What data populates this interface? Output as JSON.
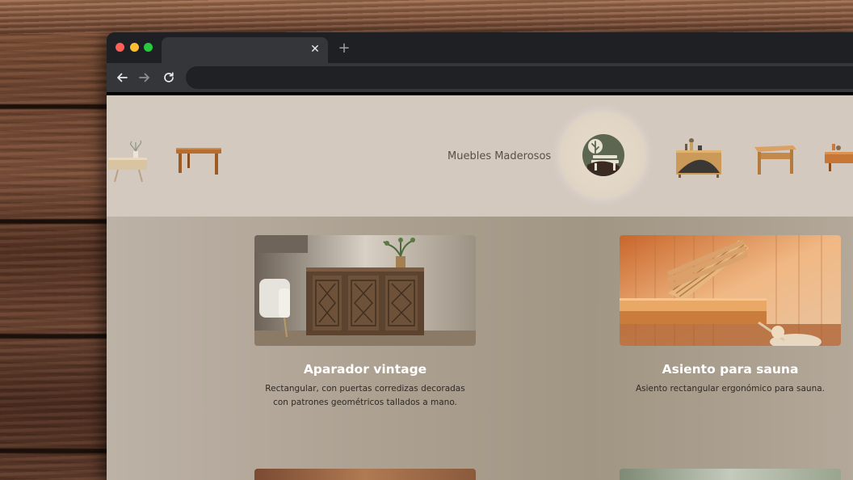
{
  "site": {
    "brand_name": "Muebles Maderosos"
  },
  "browser": {
    "tab_close_glyph": "✕",
    "new_tab_glyph": "+",
    "icons": [
      "back-arrow-icon",
      "forward-arrow-icon",
      "reload-icon",
      "close-icon",
      "plus-icon"
    ]
  },
  "header_furniture": [
    "side-table-with-plant",
    "wooden-table",
    "sideboard-with-decor",
    "wooden-desk",
    "sideboard-partial"
  ],
  "products": [
    {
      "title": "Aparador vintage",
      "description": "Rectangular, con puertas corredizas decoradas con patrones geométricos tallados a mano."
    },
    {
      "title": "Asiento para sauna",
      "description": "Asiento rectangular ergonómico para sauna."
    }
  ],
  "colors": {
    "header_bg": "#d4c9bf",
    "content_bg": "#a89c8b",
    "title_color": "#ffffff",
    "logo_green": "#5d6650"
  }
}
